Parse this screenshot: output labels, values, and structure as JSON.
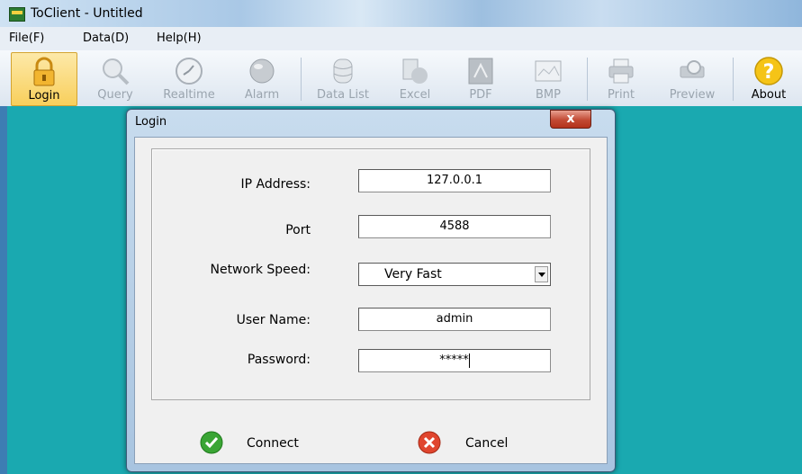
{
  "window": {
    "title": "ToClient - Untitled"
  },
  "menu": [
    {
      "label": "File(F)"
    },
    {
      "label": "Data(D)"
    },
    {
      "label": "Help(H)"
    }
  ],
  "toolbar": {
    "items": [
      {
        "label": "Login",
        "icon": "lock-icon",
        "enabled": true
      },
      {
        "label": "Query",
        "icon": "magnifier-icon",
        "enabled": false
      },
      {
        "label": "Realtime",
        "icon": "clock-icon",
        "enabled": false
      },
      {
        "label": "Alarm",
        "icon": "alarm-light-icon",
        "enabled": false
      },
      {
        "label": "Data List",
        "icon": "database-icon",
        "enabled": false
      },
      {
        "label": "Excel",
        "icon": "excel-icon",
        "enabled": false
      },
      {
        "label": "PDF",
        "icon": "pdf-icon",
        "enabled": false
      },
      {
        "label": "BMP",
        "icon": "image-icon",
        "enabled": false
      },
      {
        "label": "Print",
        "icon": "printer-icon",
        "enabled": false
      },
      {
        "label": "Preview",
        "icon": "preview-icon",
        "enabled": false
      },
      {
        "label": "About",
        "icon": "help-icon",
        "enabled": true
      }
    ]
  },
  "dialog": {
    "title": "Login",
    "close": "x",
    "fields": {
      "ip": {
        "label": "IP Address:",
        "value": "127.0.0.1"
      },
      "port": {
        "label": "Port",
        "value": "4588"
      },
      "speed": {
        "label": "Network Speed:",
        "value": "Very Fast"
      },
      "user": {
        "label": "User Name:",
        "value": "admin"
      },
      "password": {
        "label": "Password:",
        "value": "*****"
      }
    },
    "connect_label": "Connect",
    "cancel_label": "Cancel"
  },
  "colors": {
    "accent": "#f8cf5c",
    "workspace": "#1aa9b0",
    "connect": "#3aa535",
    "cancel": "#e0452e"
  }
}
